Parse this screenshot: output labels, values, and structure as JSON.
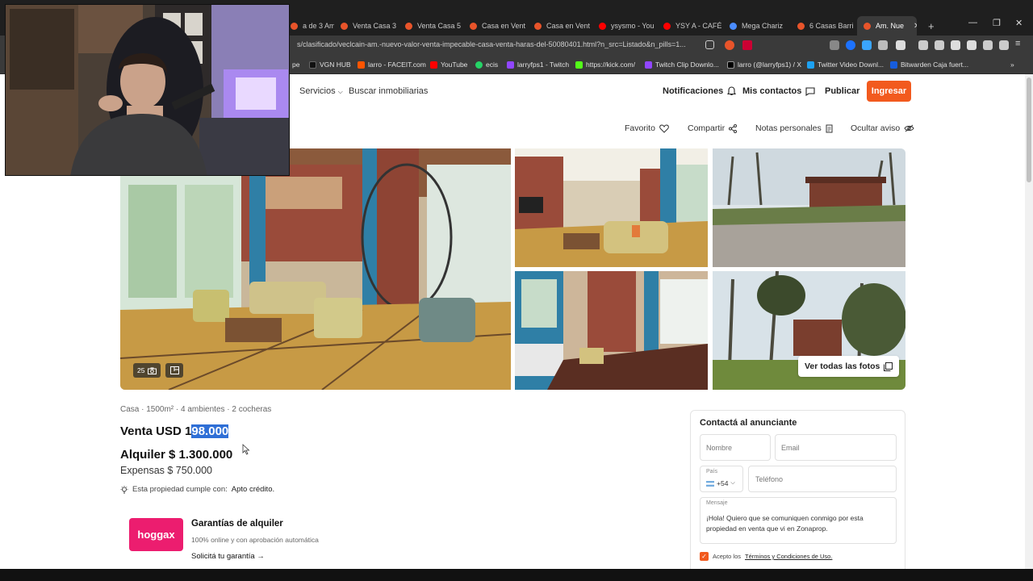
{
  "browser": {
    "tabs": [
      {
        "label": "a de 3 Am",
        "favicon_color": "#e8542a"
      },
      {
        "label": "Venta Casa 3",
        "favicon_color": "#e8542a"
      },
      {
        "label": "Venta Casa 5",
        "favicon_color": "#e8542a"
      },
      {
        "label": "Casa en Vent",
        "favicon_color": "#e8542a"
      },
      {
        "label": "Casa en Vent",
        "favicon_color": "#e8542a"
      },
      {
        "label": "ysysmo - You",
        "favicon_color": "#ff0000"
      },
      {
        "label": "YSY A - CAFÉ",
        "favicon_color": "#ff0000"
      },
      {
        "label": "Mega Chariz",
        "favicon_color": "#4a8cff"
      },
      {
        "label": "6 Casas Barri",
        "favicon_color": "#e8542a"
      },
      {
        "label": "Am. Nue",
        "favicon_color": "#e8542a"
      }
    ],
    "new_tab": "+",
    "url": "s/clasificado/veclcain-am.-nuevo-valor-venta-impecable-casa-venta-haras-del-50080401.html?n_src=Listado&n_pills=1...",
    "bookmarks": [
      {
        "label": "pe",
        "color": "#888"
      },
      {
        "label": "VGN HUB",
        "color": "#222"
      },
      {
        "label": "larro - FACEIT.com",
        "color": "#ff5500"
      },
      {
        "label": "YouTube",
        "color": "#ff0000"
      },
      {
        "label": "ecis",
        "color": "#25d366"
      },
      {
        "label": "larryfps1 - Twitch",
        "color": "#9146ff"
      },
      {
        "label": "https://kick.com/",
        "color": "#53fc18"
      },
      {
        "label": "Twitch Clip Downlo...",
        "color": "#9146ff"
      },
      {
        "label": "larro (@larryfps1) / X",
        "color": "#000"
      },
      {
        "label": "Twitter Video Downl...",
        "color": "#1da1f2"
      },
      {
        "label": "Bitwarden Caja fuert...",
        "color": "#175ddc"
      }
    ]
  },
  "header": {
    "servicios": "Servicios",
    "buscar_inmobiliarias": "Buscar inmobiliarias",
    "notificaciones": "Notificaciones",
    "mis_contactos": "Mis contactos",
    "publicar": "Publicar",
    "ingresar": "Ingresar"
  },
  "actions": {
    "favorito": "Favorito",
    "compartir": "Compartir",
    "notas": "Notas personales",
    "ocultar": "Ocultar aviso"
  },
  "gallery": {
    "photo_count": "25",
    "ver_todas": "Ver todas las fotos"
  },
  "listing": {
    "features": "Casa · 1500m² · 4 ambientes · 2 cocheras",
    "venta_prefix": "Venta USD 1",
    "venta_highlight": "98.000",
    "alquiler": "Alquiler $ 1.300.000",
    "expensas": "Expensas $ 750.000",
    "apto_prefix": "Esta propiedad cumple con:",
    "apto_value": "Apto crédito."
  },
  "hoggax": {
    "logo": "hoggax",
    "title": "Garantías de alquiler",
    "subtitle": "100% online y con aprobación automática",
    "link": "Solicitá tu garantía"
  },
  "contact": {
    "title": "Contactá al anunciante",
    "nombre_placeholder": "Nombre",
    "email_placeholder": "Email",
    "pais_label": "País",
    "pais_value": "+54",
    "telefono_placeholder": "Teléfono",
    "mensaje_label": "Mensaje",
    "mensaje_value": "¡Hola! Quiero que se comuniquen conmigo por esta propiedad en venta que vi en Zonaprop.",
    "terms_prefix": "Acepto los",
    "terms_link": "Términos y Condiciones de Uso."
  },
  "colors": {
    "accent": "#f25a1e",
    "hoggax": "#ec1d6f",
    "selection": "#2f6fd6"
  }
}
